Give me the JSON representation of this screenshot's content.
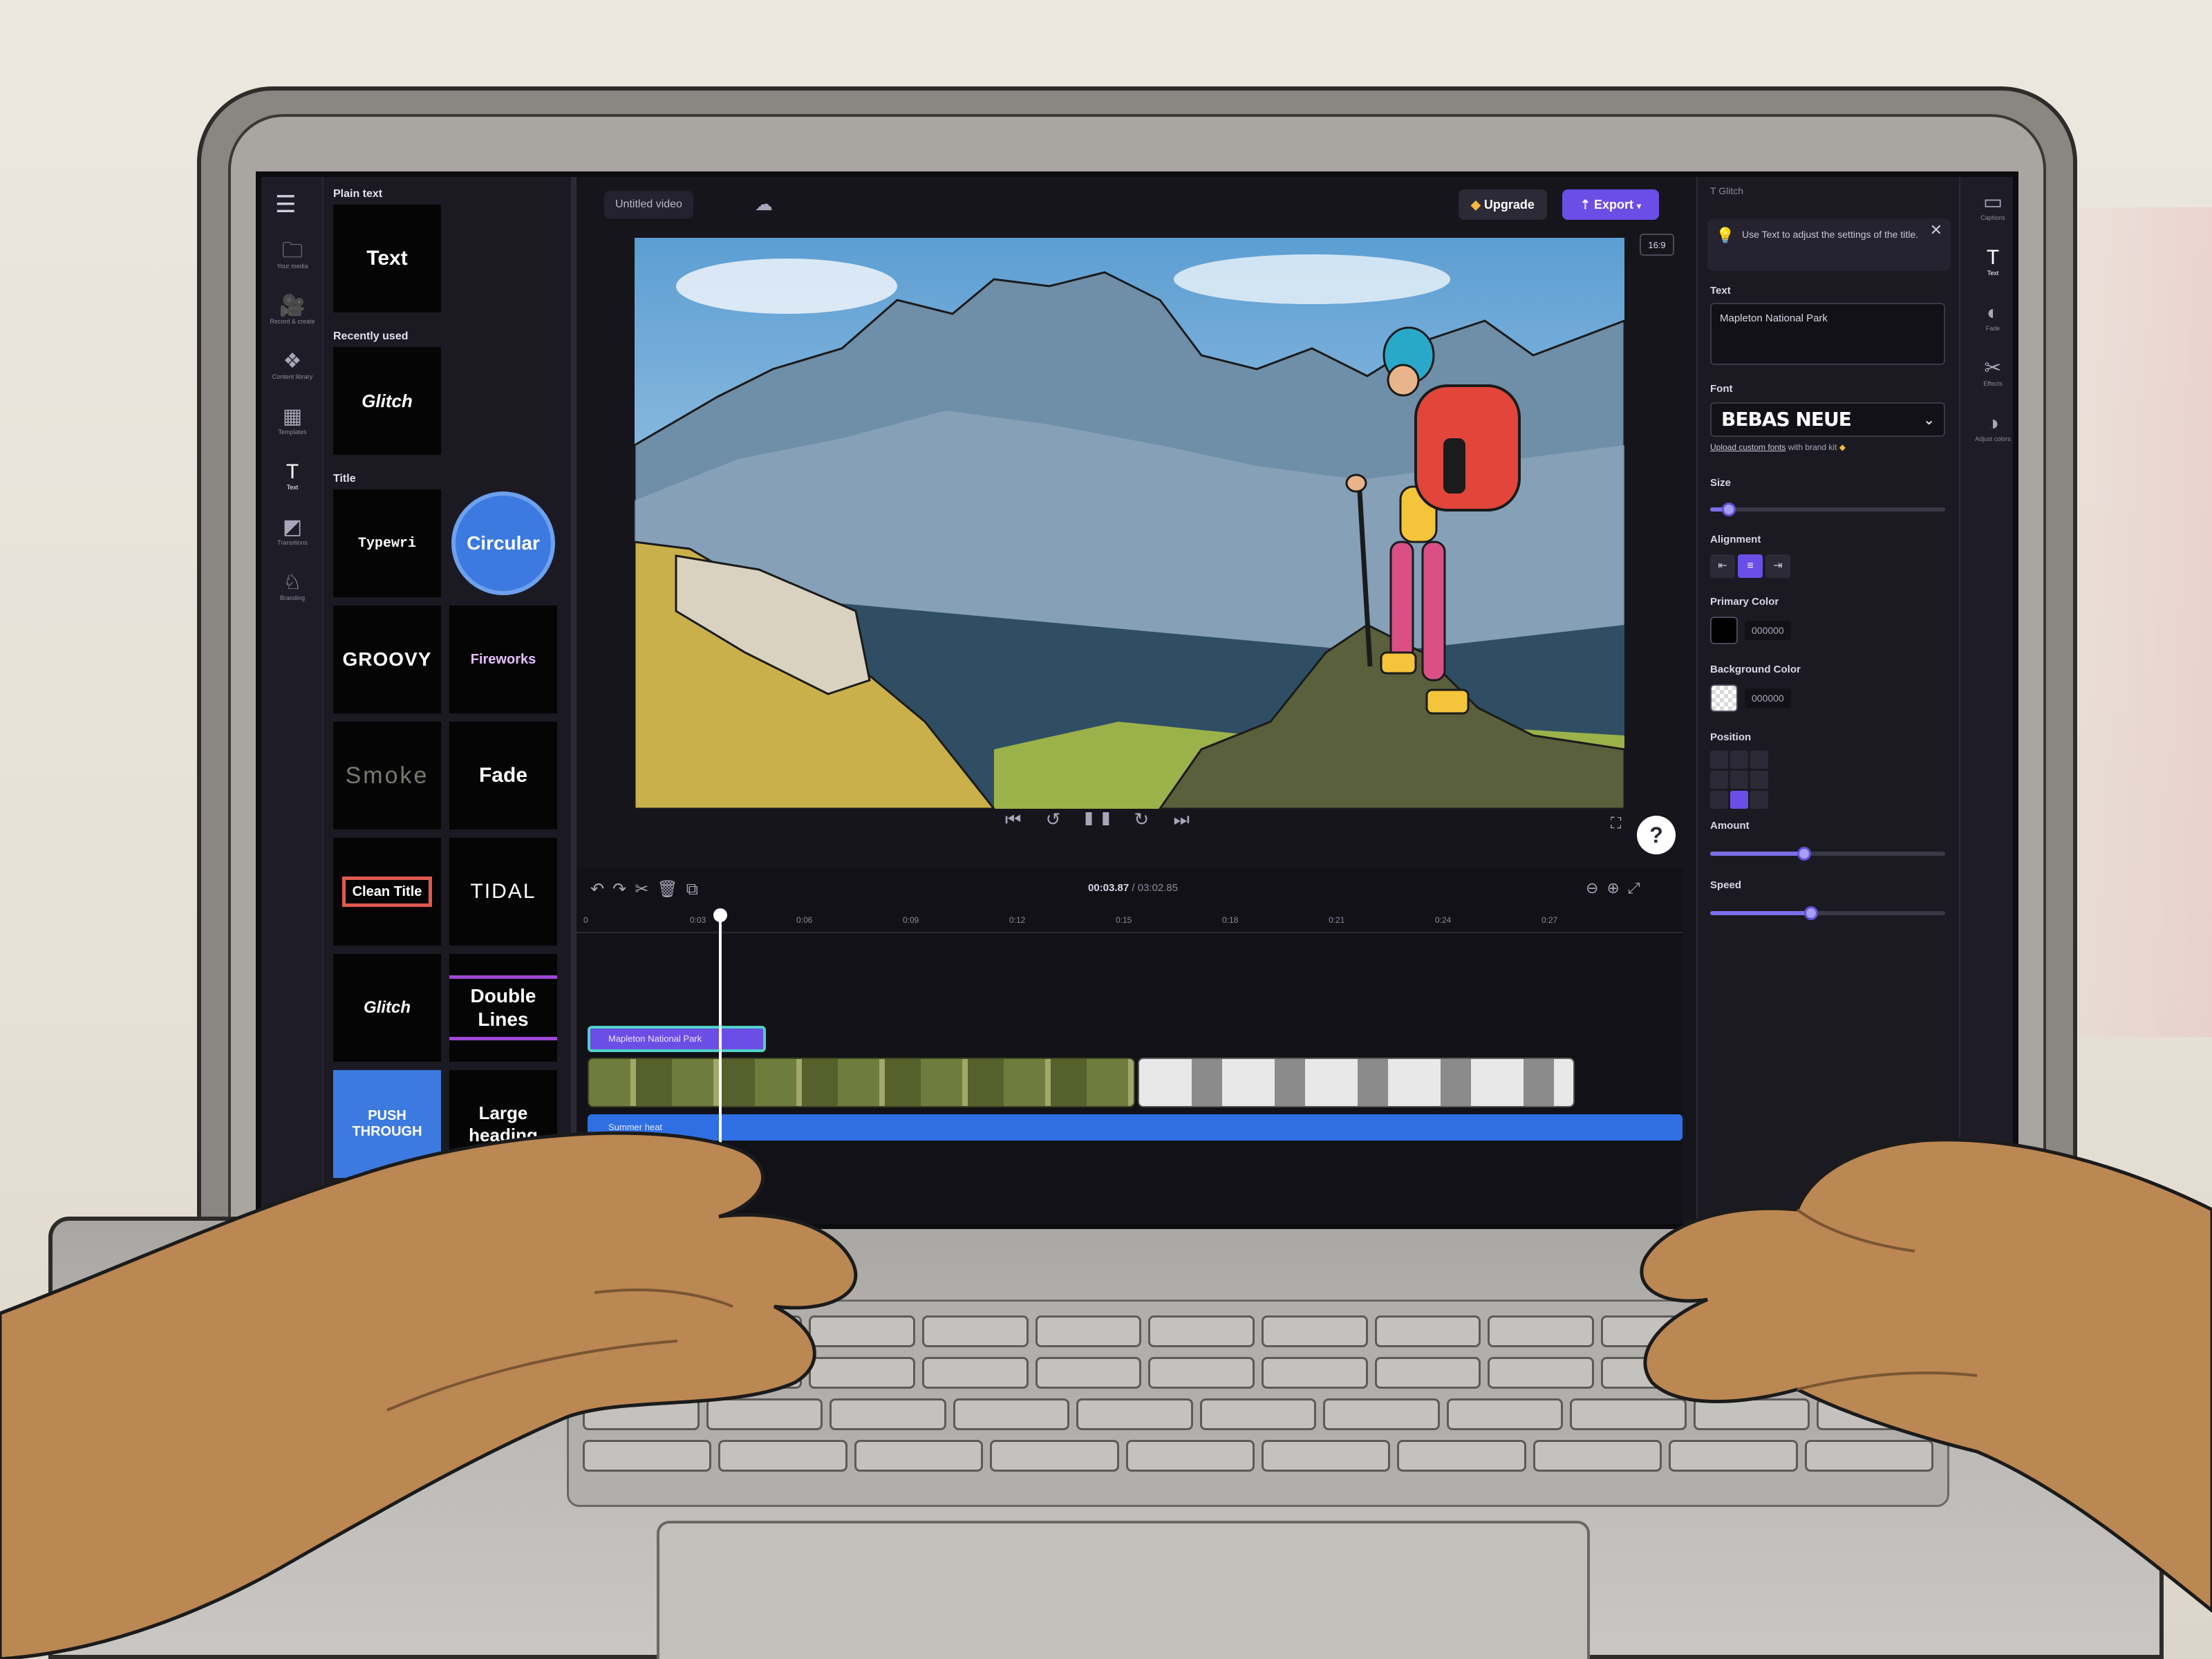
{
  "app": {
    "doc_title": "Untitled video",
    "upgrade_label": "Upgrade",
    "export_label": "Export",
    "aspect_ratio": "16:9",
    "accent_color": "#6a4ee6"
  },
  "left_rail": [
    {
      "icon": "folder-icon",
      "glyph": "🗀",
      "label": "Your media"
    },
    {
      "icon": "camera-icon",
      "glyph": "🎥",
      "label": "Record & create"
    },
    {
      "icon": "library-icon",
      "glyph": "❖",
      "label": "Content library"
    },
    {
      "icon": "templates-icon",
      "glyph": "▦",
      "label": "Templates"
    },
    {
      "icon": "text-icon",
      "glyph": "T",
      "label": "Text"
    },
    {
      "icon": "transitions-icon",
      "glyph": "◩",
      "label": "Transitions"
    },
    {
      "icon": "branding-icon",
      "glyph": "♘",
      "label": "Branding"
    }
  ],
  "library": {
    "plain_text_heading": "Plain text",
    "plain_text_tile": "Text",
    "recently_used_heading": "Recently used",
    "recent_tile": "Glitch",
    "title_heading": "Title",
    "titles": [
      "Typewri",
      "Circular",
      "GROOVY",
      "Fireworks",
      "Smoke",
      "Fade",
      "Clean Title",
      "TIDAL",
      "Glitch",
      "Double Lines",
      "PUSH THROUGH",
      "Large heading"
    ]
  },
  "playback": {
    "controls": "⏮ ↺ ❚❚ ↻ ⏭",
    "current_time": "00:03.87",
    "duration": "/ 03:02.85"
  },
  "timeline": {
    "ticks": [
      "0",
      "0:03",
      "0:06",
      "0:09",
      "0:12",
      "0:15",
      "0:18",
      "0:21",
      "0:24",
      "0:27"
    ],
    "text_clip": "Mapleton National Park",
    "audio_clip": "Summer heat"
  },
  "properties": {
    "header": "Glitch",
    "tip": "Use Text to adjust the settings of the title.",
    "text_label": "Text",
    "text_value": "Mapleton National Park",
    "font_label": "Font",
    "font_value": "BEBAS NEUE",
    "font_link": "Upload custom fonts",
    "font_link_suffix": " with brand kit",
    "size_label": "Size",
    "size_value": 0.08,
    "alignment_label": "Alignment",
    "alignment_options": [
      "⇤",
      "≡",
      "⇥"
    ],
    "primary_color_label": "Primary Color",
    "primary_color": "000000",
    "background_color_label": "Background Color",
    "background_color": "000000",
    "position_label": "Position",
    "amount_label": "Amount",
    "amount_value": 0.4,
    "speed_label": "Speed",
    "speed_value": 0.43
  },
  "right_rail": [
    {
      "icon": "captions-icon",
      "glyph": "▭",
      "label": "Captions"
    },
    {
      "icon": "text-icon",
      "glyph": "T",
      "label": "Text"
    },
    {
      "icon": "fade-icon",
      "glyph": "◐",
      "label": "Fade"
    },
    {
      "icon": "effects-icon",
      "glyph": "✂",
      "label": "Effects"
    },
    {
      "icon": "adjust-colors-icon",
      "glyph": "◑",
      "label": "Adjust colors"
    }
  ]
}
